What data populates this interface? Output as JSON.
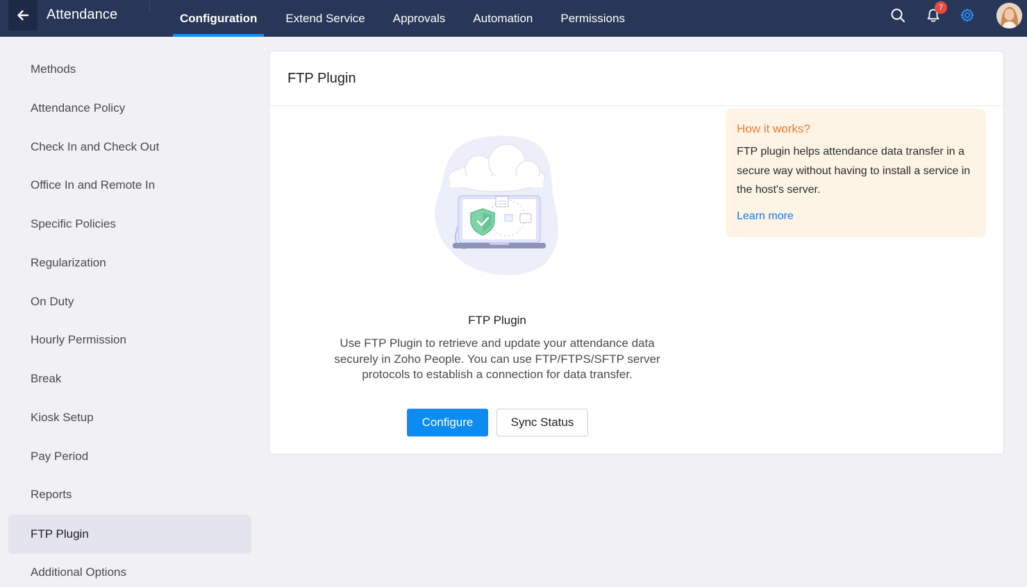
{
  "header": {
    "back_icon": "arrow-left-icon",
    "app_title": "Attendance",
    "tabs": [
      {
        "label": "Configuration",
        "active": true
      },
      {
        "label": "Extend Service",
        "active": false
      },
      {
        "label": "Approvals",
        "active": false
      },
      {
        "label": "Automation",
        "active": false
      },
      {
        "label": "Permissions",
        "active": false
      }
    ],
    "notification_count": "7",
    "icons": [
      "search-icon",
      "bell-icon",
      "gear-icon",
      "avatar"
    ]
  },
  "sidebar": {
    "items": [
      {
        "label": "Methods"
      },
      {
        "label": "Attendance Policy"
      },
      {
        "label": "Check In and Check Out"
      },
      {
        "label": "Office In and Remote In"
      },
      {
        "label": "Specific Policies"
      },
      {
        "label": "Regularization"
      },
      {
        "label": "On Duty"
      },
      {
        "label": "Hourly Permission"
      },
      {
        "label": "Break"
      },
      {
        "label": "Kiosk Setup"
      },
      {
        "label": "Pay Period"
      },
      {
        "label": "Reports"
      },
      {
        "label": "FTP Plugin",
        "active": true
      },
      {
        "label": "Additional Options"
      }
    ]
  },
  "main": {
    "title": "FTP Plugin",
    "plugin_title": "FTP Plugin",
    "description": "Use FTP Plugin to retrieve and update your attendance data securely in Zoho People. You can use FTP/FTPS/SFTP server protocols to establish a connection for data transfer.",
    "configure_label": "Configure",
    "sync_status_label": "Sync Status",
    "info": {
      "title": "How it works?",
      "text": "FTP plugin helps attendance data transfer in a secure way without having to install a service in the host's server.",
      "link": "Learn more"
    }
  },
  "colors": {
    "topbar": "#283758",
    "accent": "#0a8cf2",
    "info_title": "#f07a33",
    "info_bg": "#fdf4e5",
    "badge": "#e84a3f"
  }
}
